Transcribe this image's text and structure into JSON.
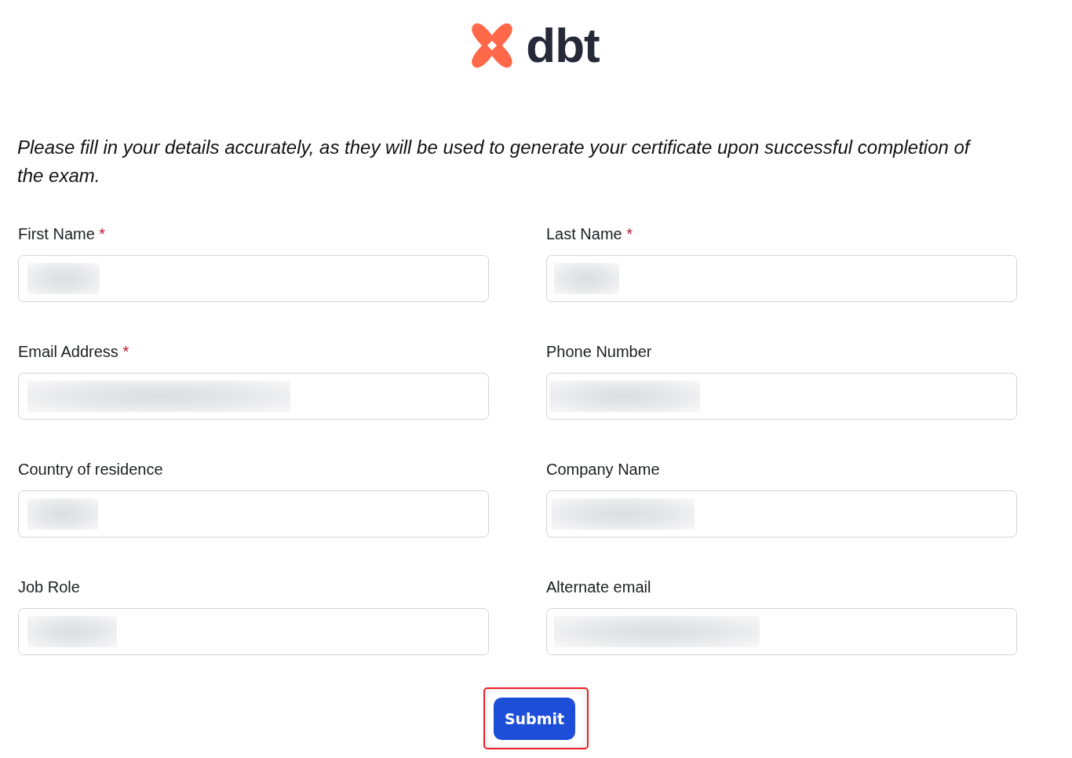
{
  "logo": {
    "text": "dbt"
  },
  "intro": "Please fill in your details accurately, as they will be used to generate your certificate upon successful completion of the exam.",
  "form": {
    "required_marker": "*",
    "fields": [
      {
        "label": "First Name",
        "required": true,
        "redacted": true
      },
      {
        "label": "Last Name",
        "required": true,
        "redacted": true
      },
      {
        "label": "Email Address",
        "required": true,
        "redacted": true
      },
      {
        "label": "Phone Number",
        "required": false,
        "redacted": true
      },
      {
        "label": "Country of residence",
        "required": false,
        "redacted": true
      },
      {
        "label": "Company Name",
        "required": false,
        "redacted": true
      },
      {
        "label": "Job Role",
        "required": false,
        "redacted": true
      },
      {
        "label": "Alternate email",
        "required": false,
        "redacted": true
      }
    ]
  },
  "submit": {
    "label": "Submit",
    "highlighted": true
  }
}
